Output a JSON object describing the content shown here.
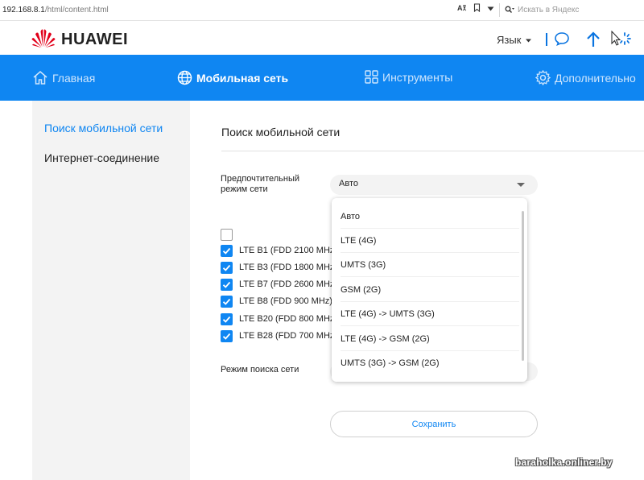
{
  "browser": {
    "url_host": "192.168.8.1",
    "url_path": "/html/content.html",
    "search_placeholder": "Искать в Яндекс"
  },
  "header": {
    "logo_text": "HUAWEI",
    "language_label": "Язык"
  },
  "nav": {
    "items": [
      {
        "label": "Главная",
        "icon": "home-icon"
      },
      {
        "label": "Мобильная сеть",
        "icon": "globe-icon"
      },
      {
        "label": "Инструменты",
        "icon": "grid-icon"
      },
      {
        "label": "Дополнительно",
        "icon": "gear-icon"
      }
    ],
    "active_index": 1
  },
  "sidebar": {
    "items": [
      {
        "label": "Поиск мобильной сети"
      },
      {
        "label": "Интернет-соединение"
      }
    ]
  },
  "main": {
    "title": "Поиск мобильной сети",
    "preferred_mode_label_line1": "Предпочтительный",
    "preferred_mode_label_line2": "режим сети",
    "preferred_mode_value": "Авто",
    "search_mode_label": "Режим поиска сети",
    "save_label": "Сохранить",
    "bands": [
      {
        "label": "LTE B1 (FDD 2100 MHz)",
        "checked": true
      },
      {
        "label": "LTE B3 (FDD 1800 MHz)",
        "checked": true
      },
      {
        "label": "LTE B7 (FDD 2600 MHz)",
        "checked": true
      },
      {
        "label": "LTE B8 (FDD 900 MHz)",
        "checked": true
      },
      {
        "label": "LTE B20 (FDD 800 MHz)",
        "checked": true
      },
      {
        "label": "LTE B28 (FDD 700 MHz)",
        "checked": true
      }
    ],
    "select_all_checked": false
  },
  "dropdown": {
    "options": [
      "Авто",
      "LTE (4G)",
      "UMTS (3G)",
      "GSM (2G)",
      "LTE (4G) -> UMTS (3G)",
      "LTE (4G) -> GSM (2G)",
      "UMTS (3G) -> GSM (2G)"
    ]
  },
  "watermark": "baraholka.onliner.by",
  "colors": {
    "accent": "#0f86f2",
    "nav_bg": "#0f86f2",
    "brand_red": "#e1001a",
    "sidebar_bg": "#f3f3f3"
  }
}
